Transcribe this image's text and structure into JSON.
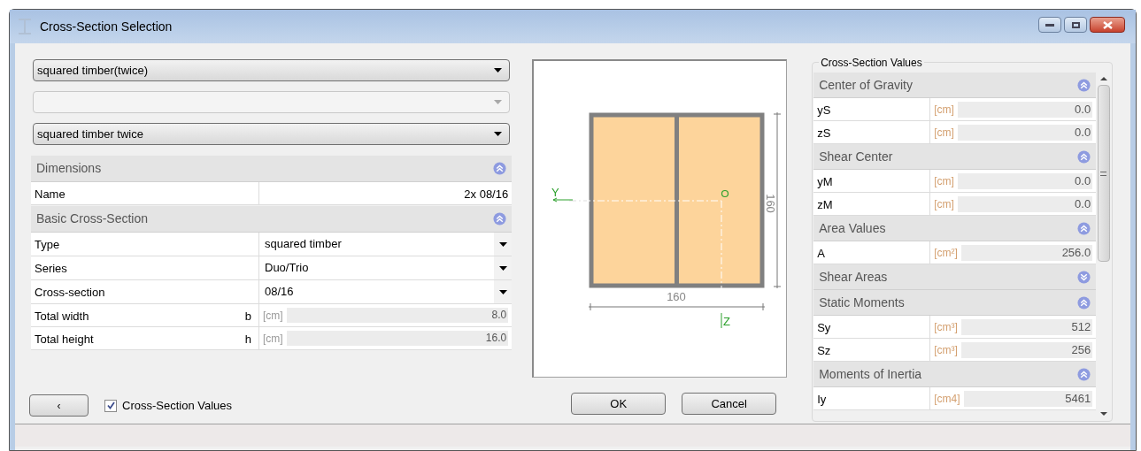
{
  "window": {
    "title": "Cross-Section Selection"
  },
  "dropdowns": [
    {
      "value": "squared timber(twice)",
      "disabled": false
    },
    {
      "disabled": true
    },
    {
      "value": "squared timber twice",
      "disabled": false
    }
  ],
  "sections": [
    {
      "title": "Dimensions",
      "expanded": true,
      "rows": [
        {
          "kind": "text",
          "label": "Name",
          "value": "2x 08/16"
        }
      ]
    },
    {
      "title": "Basic Cross-Section",
      "expanded": true,
      "rows": [
        {
          "kind": "dropdown",
          "label": "Type",
          "value": "squared timber"
        },
        {
          "kind": "dropdown",
          "label": "Series",
          "value": "Duo/Trio"
        },
        {
          "kind": "dropdown",
          "label": "Cross-section",
          "value": "08/16"
        },
        {
          "kind": "unit",
          "label": "Total width",
          "symbol": "b",
          "unit": "[cm]",
          "value": "8.0"
        },
        {
          "kind": "unit",
          "label": "Total height",
          "symbol": "h",
          "unit": "[cm]",
          "value": "16.0"
        }
      ]
    }
  ],
  "back_button": "‹",
  "show_values": {
    "label": "Cross-Section Values",
    "checked": true
  },
  "drawing": {
    "width_label": "160",
    "height_label": "160",
    "y_axis": "Y",
    "z_axis": "Z"
  },
  "buttons": [
    "OK",
    "Cancel"
  ],
  "values_panel": {
    "title": "Cross-Section Values",
    "groups": [
      {
        "title": "Center of Gravity",
        "expanded": true,
        "rows": [
          {
            "label": "yS",
            "unit": "[cm]",
            "value": "0.0"
          },
          {
            "label": "zS",
            "unit": "[cm]",
            "value": "0.0"
          }
        ]
      },
      {
        "title": "Shear Center",
        "expanded": true,
        "rows": [
          {
            "label": "yM",
            "unit": "[cm]",
            "value": "0.0"
          },
          {
            "label": "zM",
            "unit": "[cm]",
            "value": "0.0"
          }
        ]
      },
      {
        "title": "Area Values",
        "expanded": true,
        "rows": [
          {
            "label": "A",
            "unit": "[cm²]",
            "value": "256.0"
          }
        ]
      },
      {
        "title": "Shear Areas",
        "expanded": false
      },
      {
        "title": "Static Moments",
        "expanded": true,
        "rows": [
          {
            "label": "Sy",
            "unit": "[cm³]",
            "value": "512"
          },
          {
            "label": "Sz",
            "unit": "[cm³]",
            "value": "256"
          }
        ]
      },
      {
        "title": "Moments of Inertia",
        "expanded": true,
        "rows": [
          {
            "label": "Iy",
            "unit": "[cm4]",
            "value": "5461"
          }
        ]
      }
    ]
  }
}
